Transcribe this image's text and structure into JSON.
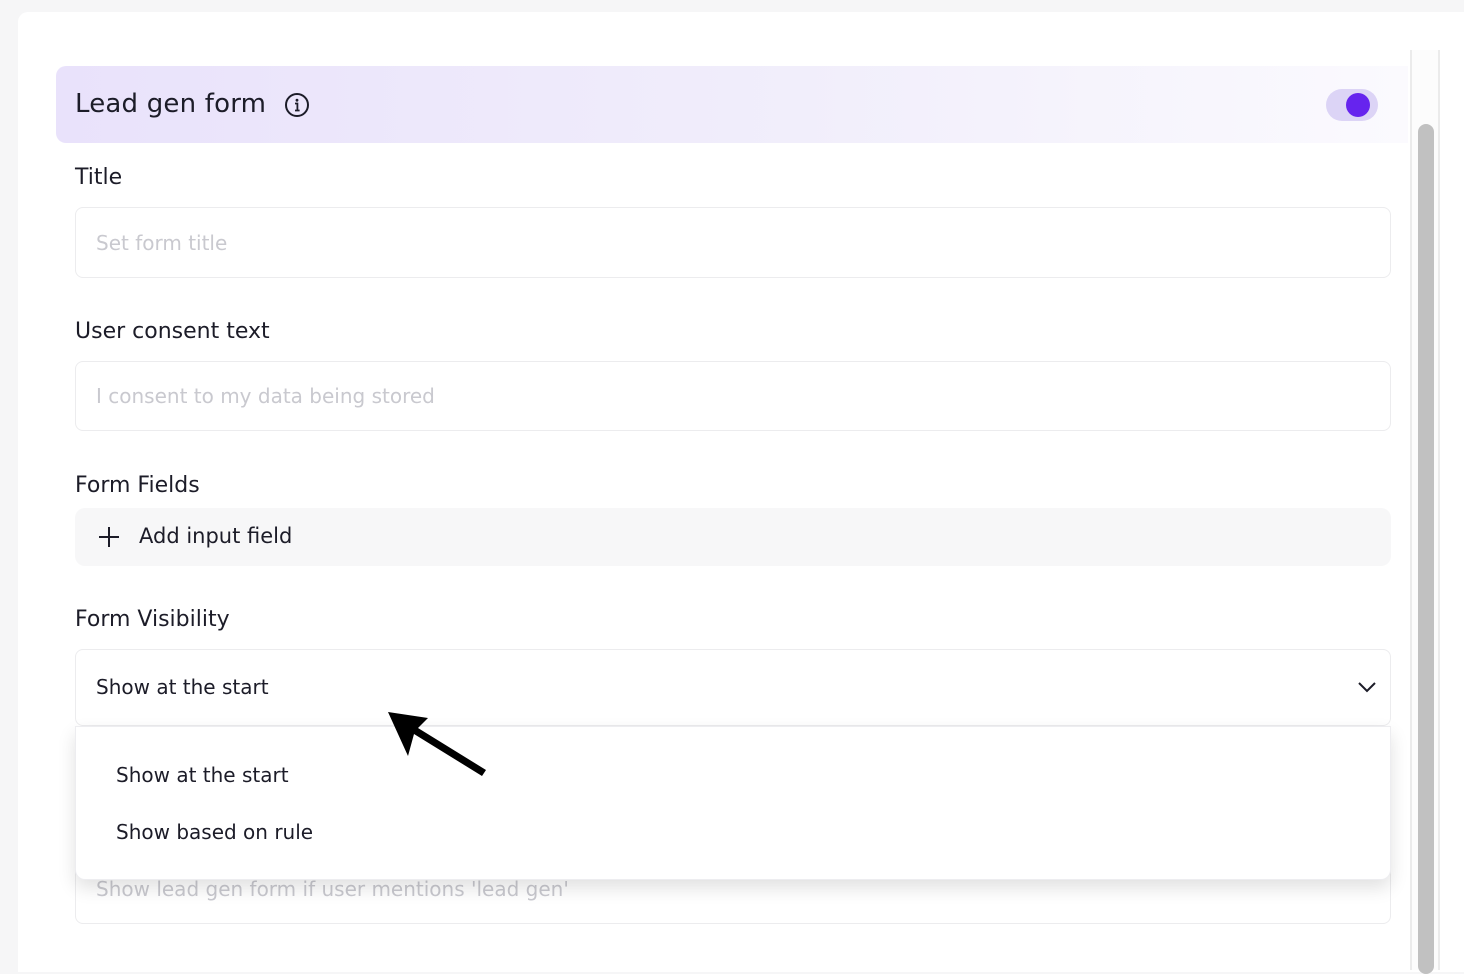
{
  "header": {
    "title": "Lead gen form",
    "toggle_on": true
  },
  "fields": {
    "title_label": "Title",
    "title_placeholder": "Set form title",
    "consent_label": "User consent text",
    "consent_placeholder": "I consent to my data being stored"
  },
  "form_fields": {
    "label": "Form Fields",
    "add_label": "Add input field"
  },
  "visibility": {
    "label": "Form Visibility",
    "selected": "Show at the start",
    "options": [
      "Show at the start",
      "Show based on rule"
    ],
    "rule_placeholder": "Show lead gen form if user mentions 'lead gen'"
  },
  "colors": {
    "accent": "#6624ee",
    "toggle_track": "#dcd4f6",
    "header_gradient_start": "#e9e2fb"
  },
  "icons": [
    "info-icon",
    "plus-icon",
    "chevron-down-icon",
    "mouse-pointer-icon"
  ]
}
